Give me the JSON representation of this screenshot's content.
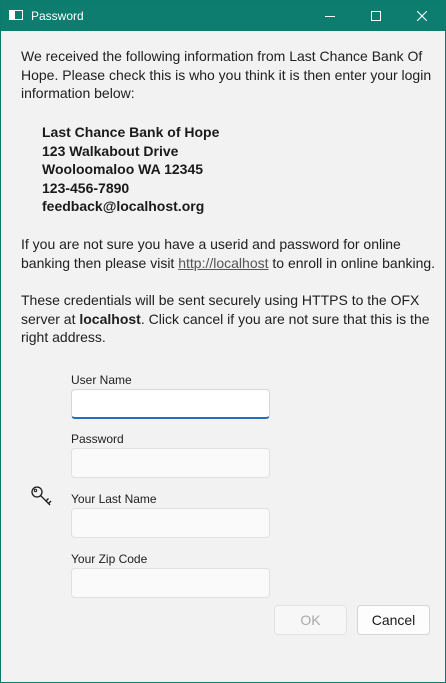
{
  "window": {
    "title": "Password",
    "icon": "app-window-icon",
    "controls": [
      "minimize-icon",
      "maximize-icon",
      "close-icon"
    ],
    "accent_color": "#0d7d6f"
  },
  "intro": {
    "line1": "We received the following information from Last Chance Bank Of",
    "line2": "Hope. Please check this is who you think it is then enter your login",
    "line3": "information below:"
  },
  "address": {
    "name": "Last Chance Bank of Hope",
    "street": "123 Walkabout Drive",
    "city": "Wooloomaloo WA 12345",
    "phone": "123-456-7890",
    "email": "feedback@localhost.org"
  },
  "enroll": {
    "line1": "If you are not sure you have a userid and password for online",
    "line2_prefix": "banking then please visit ",
    "link": "http://localhost",
    "line2_suffix": " to enroll in online banking."
  },
  "security": {
    "line1": "These credentials will be sent securely using HTTPS to the OFX",
    "line2_prefix": "server at ",
    "server": "localhost",
    "line2_suffix": ".  Click cancel if you are not sure that this is the",
    "line3": "right address."
  },
  "form": {
    "key_icon": "key-icon",
    "fields": [
      {
        "label": "User Name",
        "value": "",
        "focused": true
      },
      {
        "label": "Password",
        "value": ""
      },
      {
        "label": "Your Last Name",
        "value": ""
      },
      {
        "label": "Your Zip Code",
        "value": ""
      }
    ]
  },
  "buttons": {
    "ok": "OK",
    "cancel": "Cancel"
  }
}
